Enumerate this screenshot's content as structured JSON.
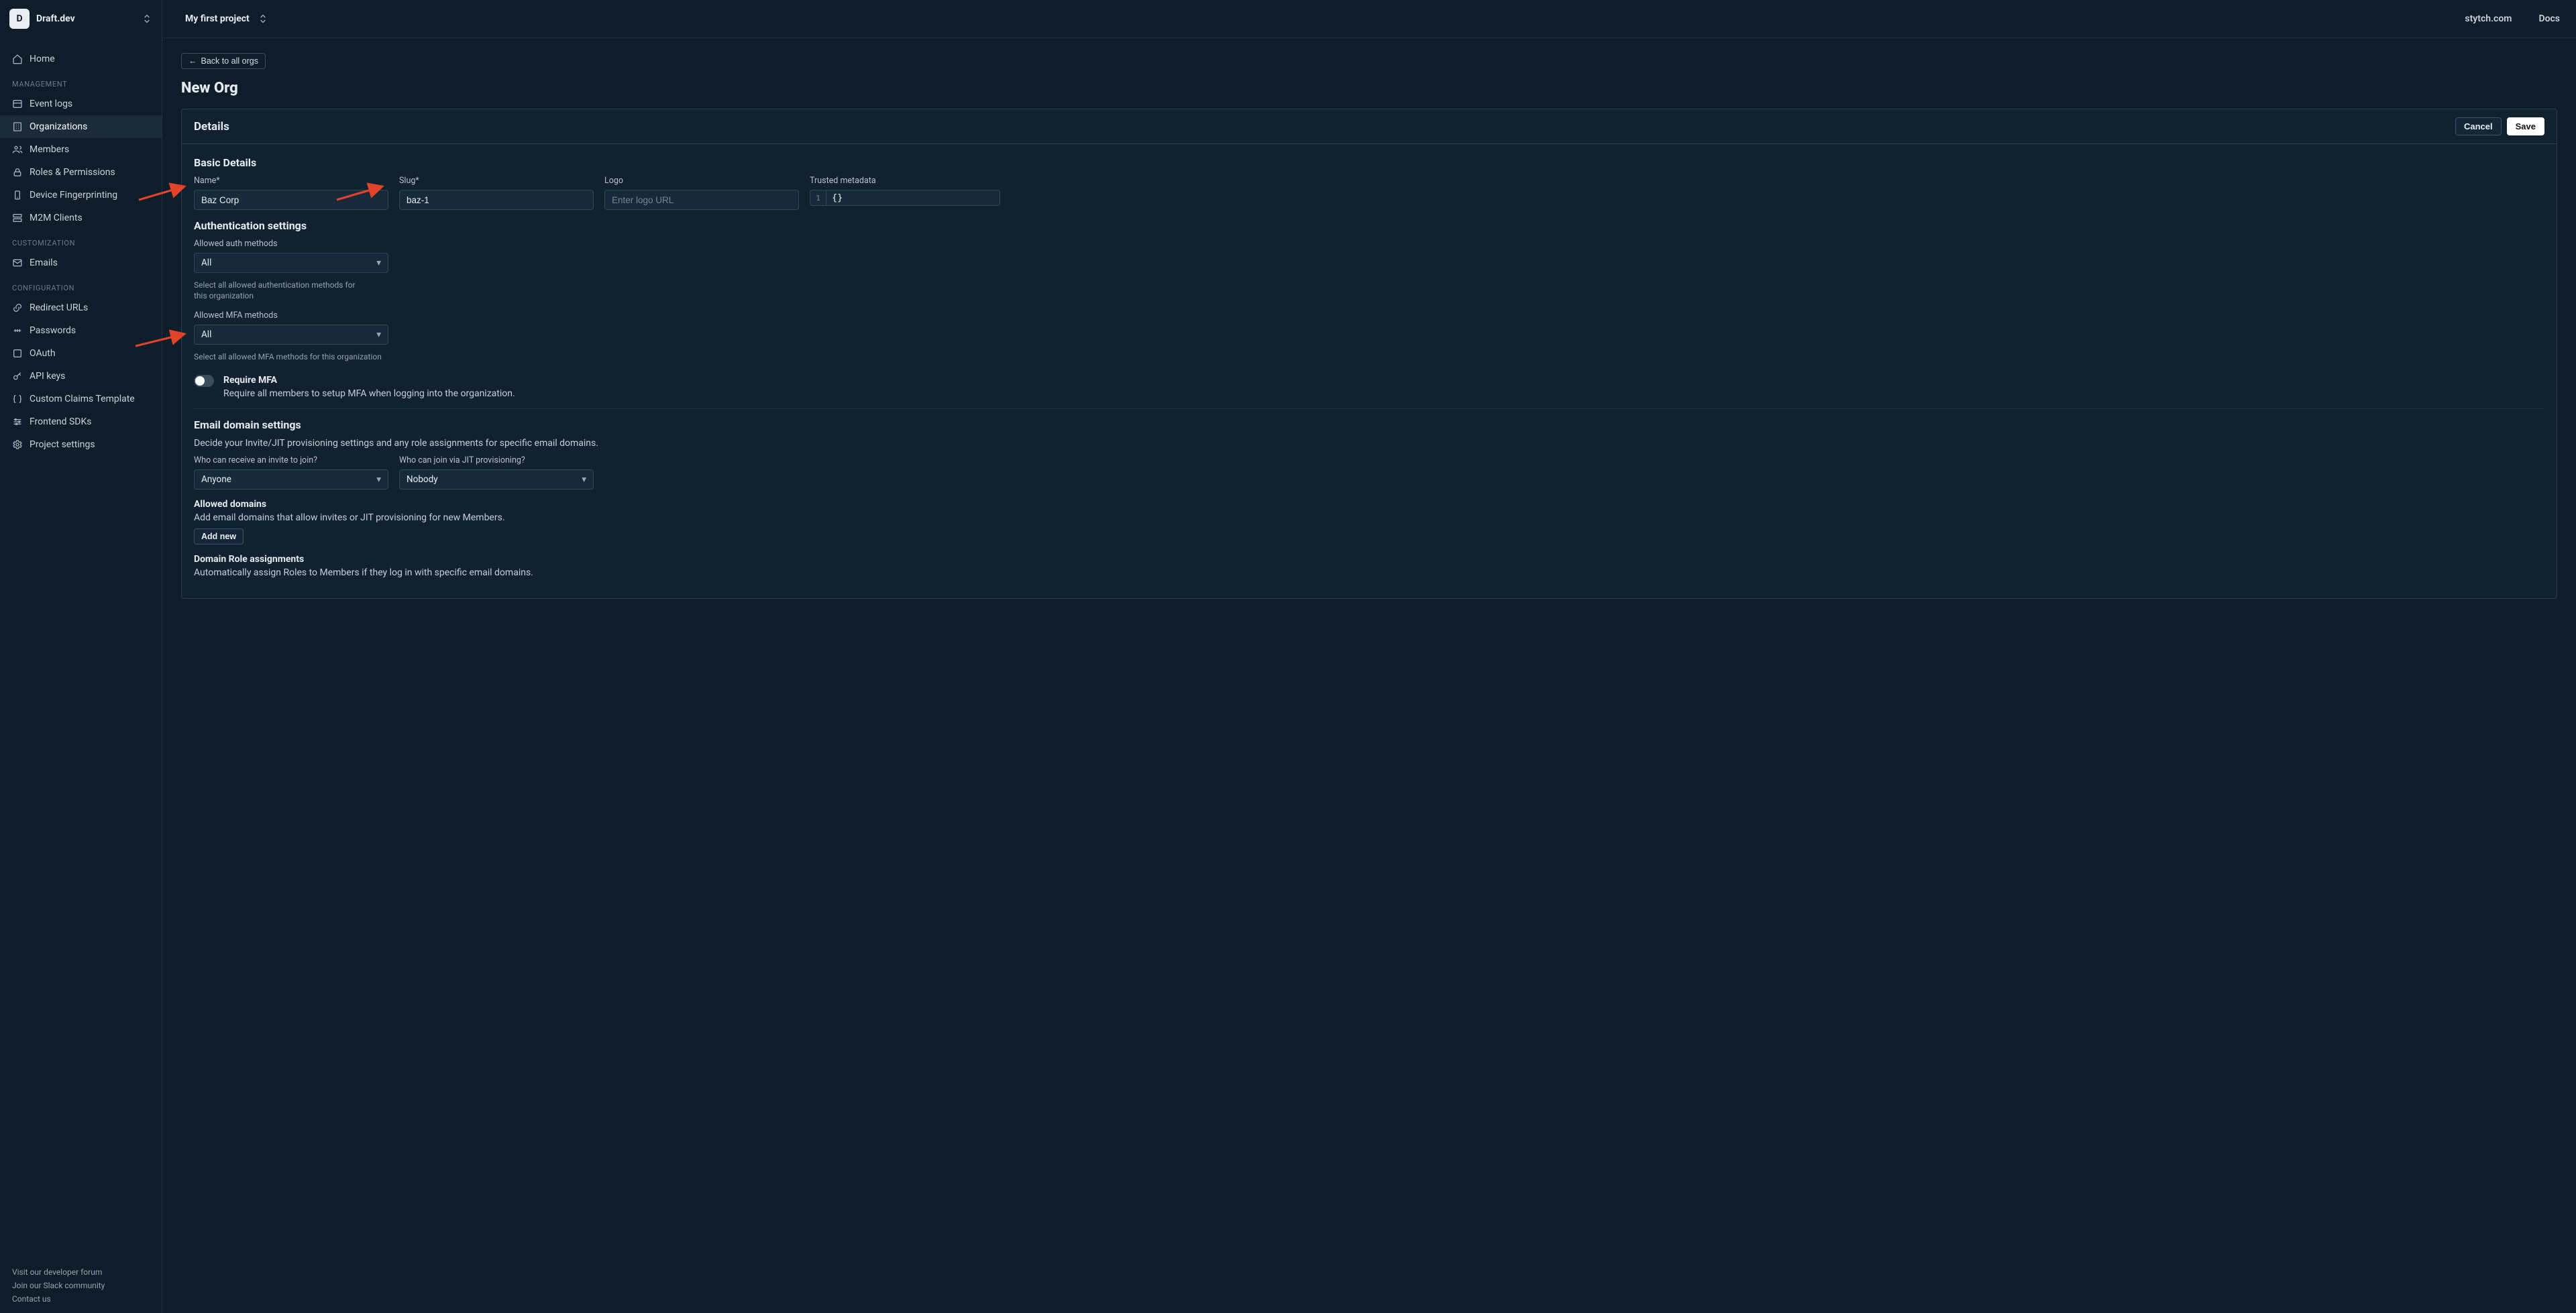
{
  "workspace": {
    "letter": "D",
    "name": "Draft.dev"
  },
  "topbar": {
    "project": "My first project",
    "links": {
      "site": "stytch.com",
      "docs": "Docs"
    }
  },
  "sidebar": {
    "items_top": [
      {
        "label": "Home"
      }
    ],
    "sections": [
      {
        "title": "MANAGEMENT",
        "items": [
          {
            "label": "Event logs"
          },
          {
            "label": "Organizations",
            "active": true
          },
          {
            "label": "Members"
          },
          {
            "label": "Roles & Permissions"
          },
          {
            "label": "Device Fingerprinting"
          },
          {
            "label": "M2M Clients"
          }
        ]
      },
      {
        "title": "CUSTOMIZATION",
        "items": [
          {
            "label": "Emails"
          }
        ]
      },
      {
        "title": "CONFIGURATION",
        "items": [
          {
            "label": "Redirect URLs"
          },
          {
            "label": "Passwords"
          },
          {
            "label": "OAuth"
          },
          {
            "label": "API keys"
          },
          {
            "label": "Custom Claims Template"
          },
          {
            "label": "Frontend SDKs"
          },
          {
            "label": "Project settings"
          }
        ]
      }
    ],
    "footer": {
      "forum": "Visit our developer forum",
      "slack": "Join our Slack community",
      "contact": "Contact us"
    }
  },
  "page": {
    "back": "Back to all orgs",
    "title": "New Org",
    "card_title": "Details",
    "cancel": "Cancel",
    "save": "Save",
    "basic": {
      "heading": "Basic Details",
      "name_label": "Name*",
      "name_value": "Baz Corp",
      "slug_label": "Slug*",
      "slug_value": "baz-1",
      "logo_label": "Logo",
      "logo_placeholder": "Enter logo URL",
      "meta_label": "Trusted metadata",
      "meta_line": "1",
      "meta_value": "{}"
    },
    "auth": {
      "heading": "Authentication settings",
      "auth_methods_label": "Allowed auth methods",
      "auth_methods_value": "All",
      "auth_methods_hint": "Select all allowed authentication methods for this organization",
      "mfa_methods_label": "Allowed MFA methods",
      "mfa_methods_value": "All",
      "mfa_methods_hint": "Select all allowed MFA methods for this organization",
      "require_mfa_label": "Require MFA",
      "require_mfa_desc": "Require all members to setup MFA when logging into the organization."
    },
    "email": {
      "heading": "Email domain settings",
      "desc": "Decide your Invite/JIT provisioning settings and any role assignments for specific email domains.",
      "invite_label": "Who can receive an invite to join?",
      "invite_value": "Anyone",
      "jit_label": "Who can join via JIT provisioning?",
      "jit_value": "Nobody",
      "allowed_title": "Allowed domains",
      "allowed_desc": "Add email domains that allow invites or JIT provisioning for new Members.",
      "add_new": "Add new",
      "roles_title": "Domain Role assignments",
      "roles_desc": "Automatically assign Roles to Members if they log in with specific email domains."
    }
  }
}
